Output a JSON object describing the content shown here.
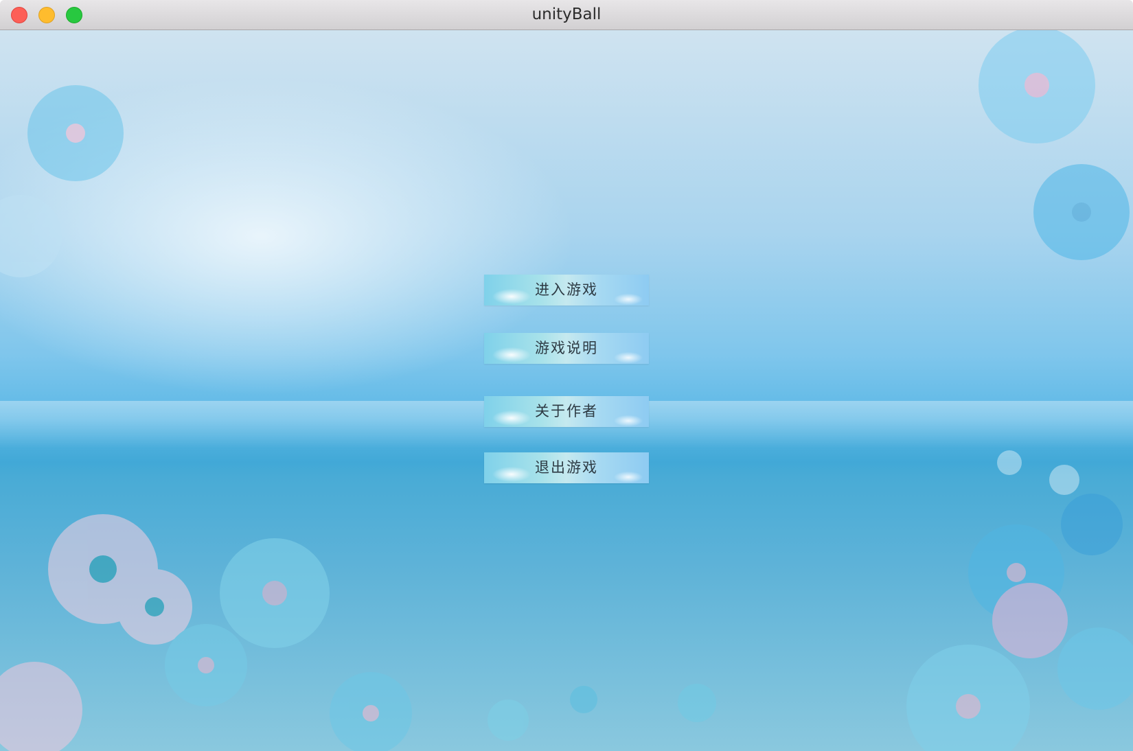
{
  "window": {
    "title": "unityBall"
  },
  "menu": {
    "items": [
      {
        "label": "进入游戏"
      },
      {
        "label": "游戏说明"
      },
      {
        "label": "关于作者"
      },
      {
        "label": "退出游戏"
      }
    ]
  },
  "colors": {
    "close": "#fd5f57",
    "minimize": "#febc2e",
    "maximize": "#28c840",
    "background_top": "#cfe3f0",
    "background_mid": "#3aa6d8"
  }
}
